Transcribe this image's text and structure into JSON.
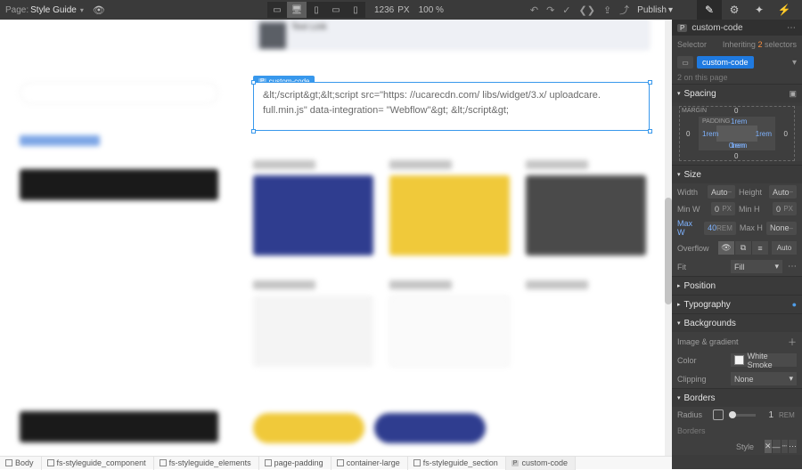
{
  "topbar": {
    "page_prefix": "Page:",
    "page_name": "Style Guide",
    "canvas_width": "1236",
    "canvas_unit": "PX",
    "zoom": "100 %",
    "publish": "Publish"
  },
  "canvas": {
    "text_link": "Text Link",
    "custom_code_tag": "custom-code",
    "custom_code_content": "&lt;/script&gt;&lt;script src=\"https: //ucarecdn.com/ libs/widget/3.x/ uploadcare. full.min.js\" data-integration= \"Webflow\"&gt; &lt;/script&gt;"
  },
  "panel": {
    "element_name": "custom-code",
    "selector_label": "Selector",
    "inheriting_label": "Inheriting",
    "inheriting_count": "2",
    "inheriting_suffix": "selectors",
    "class_pill": "custom-code",
    "on_page": "2 on this page",
    "sections": {
      "spacing": "Spacing",
      "size": "Size",
      "position": "Position",
      "typography": "Typography",
      "backgrounds": "Backgrounds",
      "borders": "Borders",
      "borders2": "Borders"
    },
    "spacing_vals": {
      "margin_label": "MARGIN",
      "padding_label": "PADDING",
      "m_top": "0",
      "m_bottom": "0",
      "m_left": "0",
      "m_right": "0",
      "p_top": "1rem",
      "p_bottom": "1rem",
      "p_left": "1rem",
      "p_right": "1rem",
      "center": "0rem"
    },
    "size": {
      "width_l": "Width",
      "width_v": "Auto",
      "height_l": "Height",
      "height_v": "Auto",
      "minw_l": "Min W",
      "minw_v": "0",
      "minw_u": "PX",
      "minh_l": "Min H",
      "minh_v": "0",
      "minh_u": "PX",
      "maxw_l": "Max W",
      "maxw_v": "40",
      "maxw_u": "REM",
      "maxh_l": "Max H",
      "maxh_v": "None",
      "overflow_l": "Overflow",
      "auto": "Auto",
      "fit_l": "Fit",
      "fit_v": "Fill"
    },
    "bg": {
      "imggrad": "Image & gradient",
      "color_l": "Color",
      "color_v": "White Smoke",
      "clip_l": "Clipping",
      "clip_v": "None"
    },
    "border": {
      "radius_l": "Radius",
      "radius_v": "1",
      "radius_u": "REM",
      "style_l": "Style"
    }
  },
  "breadcrumb": [
    {
      "icon": "box",
      "label": "Body"
    },
    {
      "icon": "box",
      "label": "fs-styleguide_component"
    },
    {
      "icon": "box",
      "label": "fs-styleguide_elements"
    },
    {
      "icon": "box",
      "label": "page-padding"
    },
    {
      "icon": "box",
      "label": "container-large"
    },
    {
      "icon": "box",
      "label": "fs-styleguide_section"
    },
    {
      "icon": "p",
      "label": "custom-code"
    }
  ]
}
